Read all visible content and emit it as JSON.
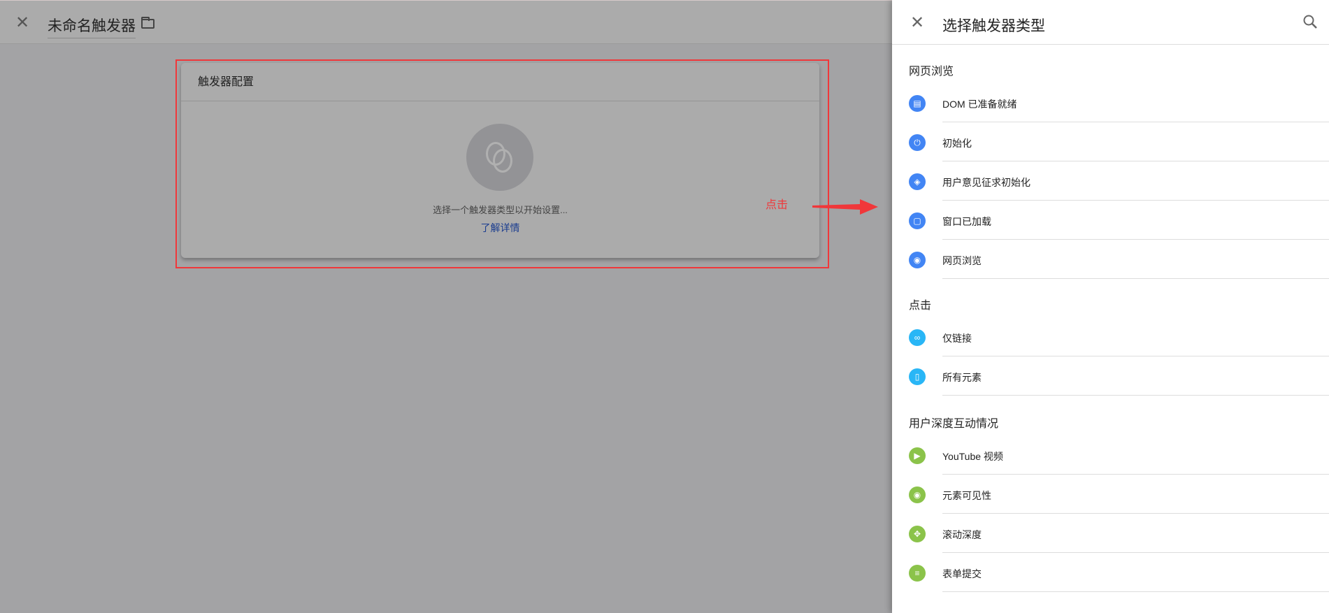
{
  "topbar": {
    "title": "未命名触发器",
    "close_icon": "close-icon",
    "folder_icon": "folder-icon"
  },
  "card": {
    "title": "触发器配置",
    "hint": "选择一个触发器类型以开始设置...",
    "link": "了解详情"
  },
  "annotation": {
    "label": "点击",
    "color": "#f0373a"
  },
  "panel": {
    "title": "选择触发器类型",
    "sections": [
      {
        "title": "网页浏览",
        "items": [
          {
            "label": "DOM 已准备就绪",
            "icon": "document-icon",
            "color": "#4285f4",
            "glyph": "▤"
          },
          {
            "label": "初始化",
            "icon": "power-icon",
            "color": "#4285f4",
            "glyph": "⏻"
          },
          {
            "label": "用户意见征求初始化",
            "icon": "shield-icon",
            "color": "#4285f4",
            "glyph": "◈"
          },
          {
            "label": "窗口已加载",
            "icon": "window-icon",
            "color": "#4285f4",
            "glyph": "▢"
          },
          {
            "label": "网页浏览",
            "icon": "eye-icon",
            "color": "#4285f4",
            "glyph": "◉"
          }
        ]
      },
      {
        "title": "点击",
        "items": [
          {
            "label": "仅链接",
            "icon": "link-icon",
            "color": "#29b6f6",
            "glyph": "∞"
          },
          {
            "label": "所有元素",
            "icon": "mouse-icon",
            "color": "#29b6f6",
            "glyph": "▯"
          }
        ]
      },
      {
        "title": "用户深度互动情况",
        "items": [
          {
            "label": "YouTube 视频",
            "icon": "play-icon",
            "color": "#8bc34a",
            "glyph": "▶"
          },
          {
            "label": "元素可见性",
            "icon": "eye-icon",
            "color": "#8bc34a",
            "glyph": "◉"
          },
          {
            "label": "滚动深度",
            "icon": "move-icon",
            "color": "#8bc34a",
            "glyph": "✥"
          },
          {
            "label": "表单提交",
            "icon": "form-check-icon",
            "color": "#8bc34a",
            "glyph": "≡"
          }
        ]
      }
    ]
  }
}
